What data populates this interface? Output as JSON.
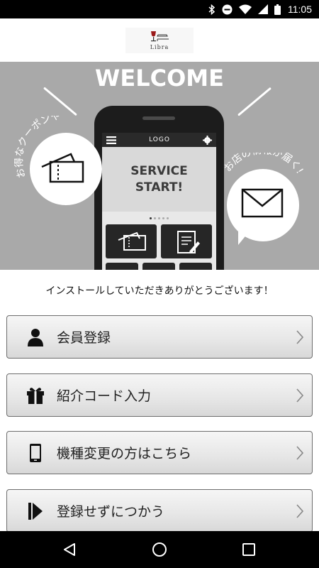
{
  "status_bar": {
    "time": "11:05",
    "icons": [
      "bluetooth-icon",
      "do-not-disturb-icon",
      "wifi-icon",
      "signal-icon",
      "battery-icon"
    ]
  },
  "header": {
    "logo_text": "Libra",
    "logo_icon": "wine-glass-icon"
  },
  "hero": {
    "title": "WELCOME",
    "left_bubble_text": "お得なクーポンや",
    "right_bubble_text": "お店の情報が届く!",
    "phone": {
      "header_logo": "LOGO",
      "banner_line1": "SERVICE",
      "banner_line2": "START!"
    }
  },
  "thanks_message": "インストールしていただきありがとうございます！",
  "menu": [
    {
      "label": "会員登録",
      "icon": "person-icon"
    },
    {
      "label": "紹介コード入力",
      "icon": "gift-icon"
    },
    {
      "label": "機種変更の方はこちら",
      "icon": "smartphone-icon"
    },
    {
      "label": "登録せずにつかう",
      "icon": "skip-icon"
    }
  ],
  "nav_bar": {
    "buttons": [
      "back-icon",
      "home-icon",
      "recents-icon"
    ]
  },
  "colors": {
    "hero_bg": "#a9a9a9",
    "status_bar_bg": "#000000",
    "button_border": "#6d6d6d"
  }
}
